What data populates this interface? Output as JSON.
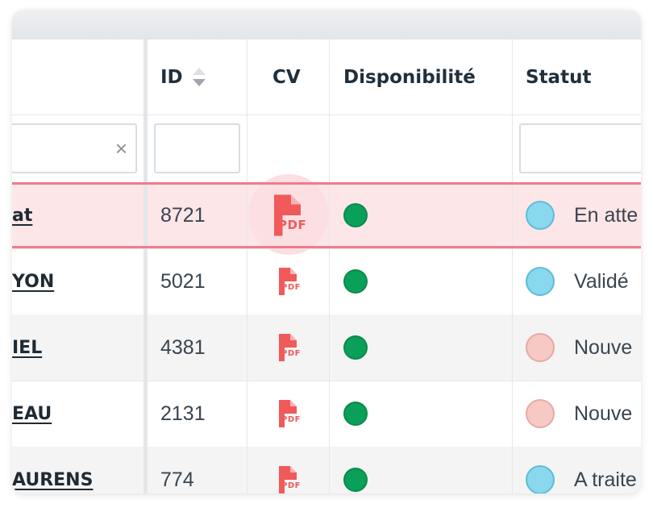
{
  "columns": {
    "id": "ID",
    "cv": "CV",
    "availability": "Disponibilité",
    "status": "Statut"
  },
  "rows": [
    {
      "name": "at",
      "id": "8721",
      "cv": "PDF",
      "status": "En atte",
      "status_color": "#8ad8ee",
      "selected": true
    },
    {
      "name": "YON",
      "id": "5021",
      "cv": "PDF",
      "status": "Validé",
      "status_color": "#8ad8ee"
    },
    {
      "name": "IEL",
      "id": "4381",
      "cv": "PDF",
      "status": "Nouve",
      "status_color": "#f6c9c5"
    },
    {
      "name": "EAU",
      "id": "2131",
      "cv": "PDF",
      "status": "Nouve",
      "status_color": "#f6c9c5"
    },
    {
      "name": "AURENS",
      "id": "774",
      "cv": "PDF",
      "status": "A traite",
      "status_color": "#8ad8ee"
    }
  ],
  "colors": {
    "pdf": "#f05a5a",
    "available": "#0aa05a",
    "selection": "#f07b8a"
  }
}
